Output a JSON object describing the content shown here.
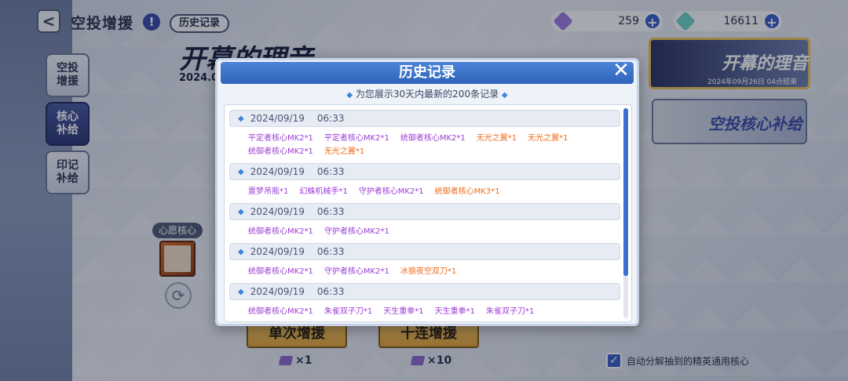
{
  "header": {
    "title": "空投增援",
    "info_icon": "!",
    "history_button": "历史记录",
    "back_icon": "<"
  },
  "currencies": [
    {
      "value": "259",
      "icon": "ticket-gem-icon",
      "color": "#9b7be0"
    },
    {
      "value": "16611",
      "icon": "crystal-icon",
      "color": "#6fd1c8"
    }
  ],
  "side_tabs": [
    {
      "label_line1": "空投",
      "label_line2": "增援"
    },
    {
      "label_line1": "核心",
      "label_line2": "补给"
    },
    {
      "label_line1": "印记",
      "label_line2": "补给"
    }
  ],
  "wish": {
    "label": "心愿核心"
  },
  "background_event": {
    "title": "开幕的理音",
    "date": "2024.0"
  },
  "banners": [
    {
      "title": "开幕的理音",
      "date": "2024年09月26日 04点结束"
    },
    {
      "title": "空投核心补给"
    }
  ],
  "pull_buttons": [
    {
      "label": "单次增援",
      "cost": "×1"
    },
    {
      "label": "十连增援",
      "cost": "×10"
    }
  ],
  "auto_decompose": {
    "label": "自动分解抽到的精英通用核心",
    "checked": true
  },
  "modal": {
    "title": "历史记录",
    "close_icon": "✕",
    "subtitle": "为您展示30天内最新的200条记录",
    "records": [
      {
        "date": "2024/09/19",
        "time": "06:33",
        "items": [
          {
            "text": "平定者核心MK2*1",
            "rarity": "purple"
          },
          {
            "text": "平定者核心MK2*1",
            "rarity": "purple"
          },
          {
            "text": "统御者核心MK2*1",
            "rarity": "purple"
          },
          {
            "text": "无光之翼*1",
            "rarity": "orange"
          },
          {
            "text": "无光之翼*1",
            "rarity": "orange"
          },
          {
            "text": "统御者核心MK2*1",
            "rarity": "purple"
          },
          {
            "text": "无光之翼*1",
            "rarity": "orange"
          }
        ]
      },
      {
        "date": "2024/09/19",
        "time": "06:33",
        "items": [
          {
            "text": "噩梦吊瓶*1",
            "rarity": "purple"
          },
          {
            "text": "幻蛛机械手*1",
            "rarity": "purple"
          },
          {
            "text": "守护者核心MK2*1",
            "rarity": "purple"
          },
          {
            "text": "统御者核心MK3*1",
            "rarity": "orange"
          }
        ]
      },
      {
        "date": "2024/09/19",
        "time": "06:33",
        "items": [
          {
            "text": "统御者核心MK2*1",
            "rarity": "purple"
          },
          {
            "text": "守护者核心MK2*1",
            "rarity": "purple"
          }
        ]
      },
      {
        "date": "2024/09/19",
        "time": "06:33",
        "items": [
          {
            "text": "统御者核心MK2*1",
            "rarity": "purple"
          },
          {
            "text": "守护者核心MK2*1",
            "rarity": "purple"
          },
          {
            "text": "冰狼夜空双刀*1",
            "rarity": "orange"
          }
        ]
      },
      {
        "date": "2024/09/19",
        "time": "06:33",
        "items": [
          {
            "text": "统御者核心MK2*1",
            "rarity": "purple"
          },
          {
            "text": "朱雀双子刀*1",
            "rarity": "purple"
          },
          {
            "text": "天生重拳*1",
            "rarity": "purple"
          },
          {
            "text": "天生重拳*1",
            "rarity": "purple"
          },
          {
            "text": "朱雀双子刀*1",
            "rarity": "purple"
          }
        ]
      }
    ]
  }
}
